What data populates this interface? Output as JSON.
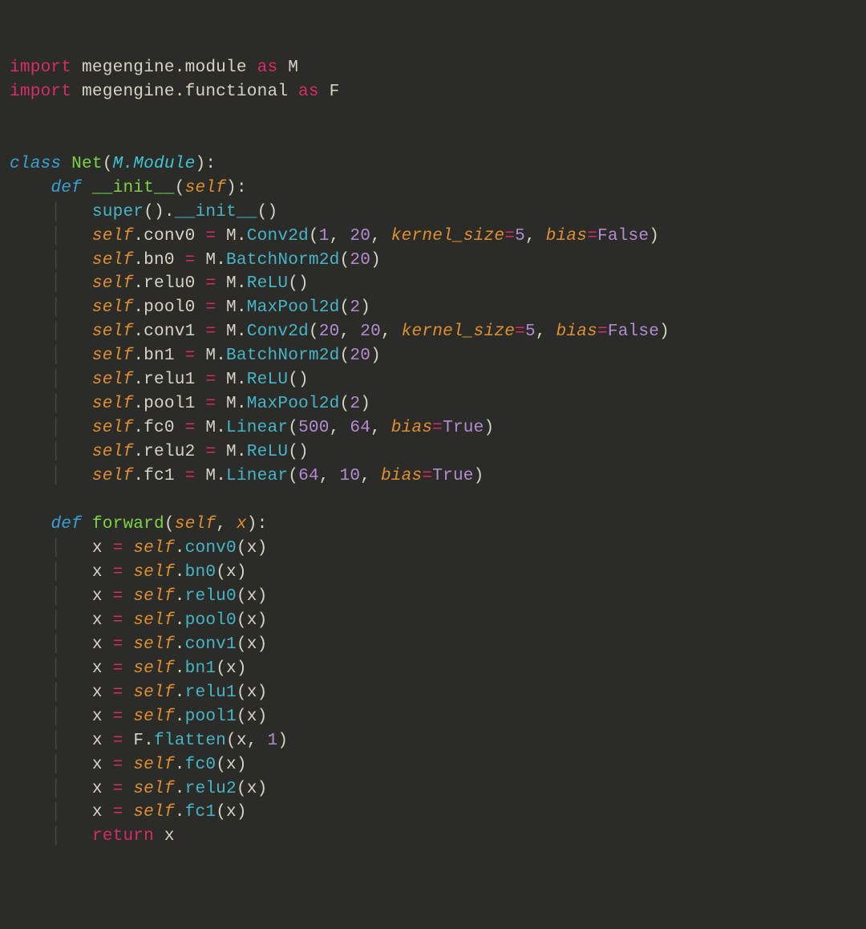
{
  "code": {
    "language": "python",
    "imports": [
      {
        "module": "megengine.module",
        "alias": "M"
      },
      {
        "module": "megengine.functional",
        "alias": "F"
      }
    ],
    "class": {
      "name": "Net",
      "base": "M.Module",
      "init": {
        "signature": "self",
        "super_call": "super().__init__()",
        "assignments": [
          {
            "target": "self.conv0",
            "call": "M.Conv2d",
            "args": [
              1,
              20
            ],
            "kwargs": {
              "kernel_size": 5,
              "bias": false
            }
          },
          {
            "target": "self.bn0",
            "call": "M.BatchNorm2d",
            "args": [
              20
            ]
          },
          {
            "target": "self.relu0",
            "call": "M.ReLU",
            "args": []
          },
          {
            "target": "self.pool0",
            "call": "M.MaxPool2d",
            "args": [
              2
            ]
          },
          {
            "target": "self.conv1",
            "call": "M.Conv2d",
            "args": [
              20,
              20
            ],
            "kwargs": {
              "kernel_size": 5,
              "bias": false
            }
          },
          {
            "target": "self.bn1",
            "call": "M.BatchNorm2d",
            "args": [
              20
            ]
          },
          {
            "target": "self.relu1",
            "call": "M.ReLU",
            "args": []
          },
          {
            "target": "self.pool1",
            "call": "M.MaxPool2d",
            "args": [
              2
            ]
          },
          {
            "target": "self.fc0",
            "call": "M.Linear",
            "args": [
              500,
              64
            ],
            "kwargs": {
              "bias": true
            }
          },
          {
            "target": "self.relu2",
            "call": "M.ReLU",
            "args": []
          },
          {
            "target": "self.fc1",
            "call": "M.Linear",
            "args": [
              64,
              10
            ],
            "kwargs": {
              "bias": true
            }
          }
        ]
      },
      "forward": {
        "signature": "self, x",
        "body": [
          "x = self.conv0(x)",
          "x = self.bn0(x)",
          "x = self.relu0(x)",
          "x = self.pool0(x)",
          "x = self.conv1(x)",
          "x = self.bn1(x)",
          "x = self.relu1(x)",
          "x = self.pool1(x)",
          "x = F.flatten(x, 1)",
          "x = self.fc0(x)",
          "x = self.relu2(x)",
          "x = self.fc1(x)",
          "return x"
        ]
      }
    }
  },
  "tokens": {
    "import": "import",
    "as": "as",
    "class": "class",
    "def": "def",
    "return": "return",
    "self": "self",
    "x": "x",
    "M": "M",
    "F": "F",
    "mod_module": "megengine.module",
    "mod_functional": "megengine.functional",
    "Net": "Net",
    "MModule": "M.Module",
    "init": "__init__",
    "forward": "forward",
    "super": "super",
    "initcall": "__init__",
    "Conv2d": "Conv2d",
    "BatchNorm2d": "BatchNorm2d",
    "ReLU": "ReLU",
    "MaxPool2d": "MaxPool2d",
    "Linear": "Linear",
    "flatten": "flatten",
    "kernel_size": "kernel_size",
    "bias": "bias",
    "True": "True",
    "False": "False",
    "n1": "1",
    "n2": "2",
    "n5": "5",
    "n10": "10",
    "n20": "20",
    "n64": "64",
    "n500": "500",
    "conv0": "conv0",
    "bn0": "bn0",
    "relu0": "relu0",
    "pool0": "pool0",
    "conv1": "conv1",
    "bn1": "bn1",
    "relu1": "relu1",
    "pool1": "pool1",
    "fc0": "fc0",
    "relu2": "relu2",
    "fc1": "fc1"
  }
}
